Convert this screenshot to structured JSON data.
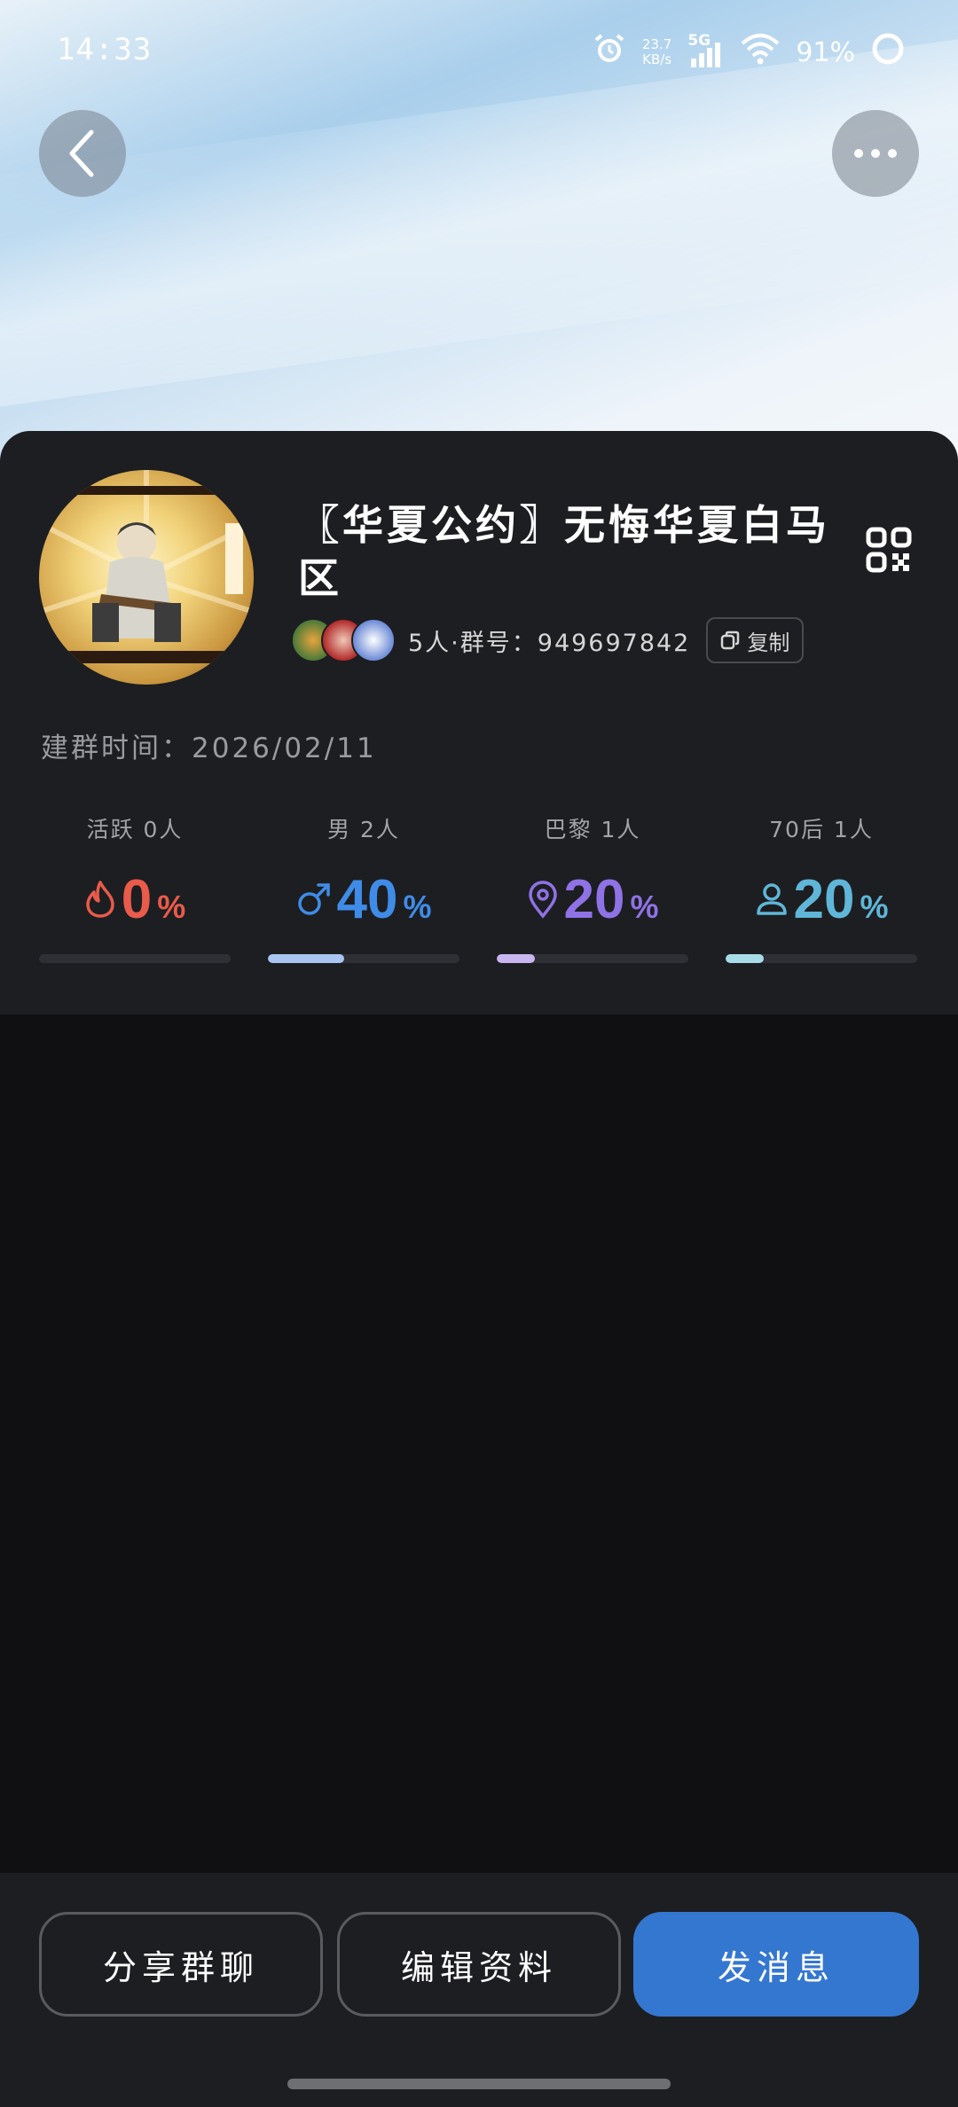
{
  "status": {
    "time": "14:33",
    "speed": "23.7",
    "speed_unit": "KB/s",
    "net": "5G",
    "battery": "91%"
  },
  "header": {
    "back_icon": "chevron-left-icon",
    "more_icon": "more-dots-icon"
  },
  "group": {
    "title": "〖华夏公约〗无悔华夏白马区",
    "meta": "5人·群号：949697842",
    "copy_label": "复制",
    "created": "建群时间：2026/02/11"
  },
  "stats": [
    {
      "label": "活跃 0人",
      "value": "0",
      "unit": "%",
      "percent": 0,
      "color": "#e95b4b",
      "icon": "flame-icon"
    },
    {
      "label": "男 2人",
      "value": "40",
      "unit": "%",
      "percent": 40,
      "color": "#3f8ce8",
      "icon": "male-icon"
    },
    {
      "label": "巴黎 1人",
      "value": "20",
      "unit": "%",
      "percent": 20,
      "color": "#8f72e6",
      "icon": "location-icon"
    },
    {
      "label": "70后 1人",
      "value": "20",
      "unit": "%",
      "percent": 20,
      "color": "#5fb6d8",
      "icon": "person-icon"
    }
  ],
  "bar_colors": [
    "#e95b4b",
    "#a9c6f2",
    "#c7b6f0",
    "#a8dce8"
  ],
  "actions": {
    "share": "分享群聊",
    "edit": "编辑资料",
    "send": "发消息"
  }
}
